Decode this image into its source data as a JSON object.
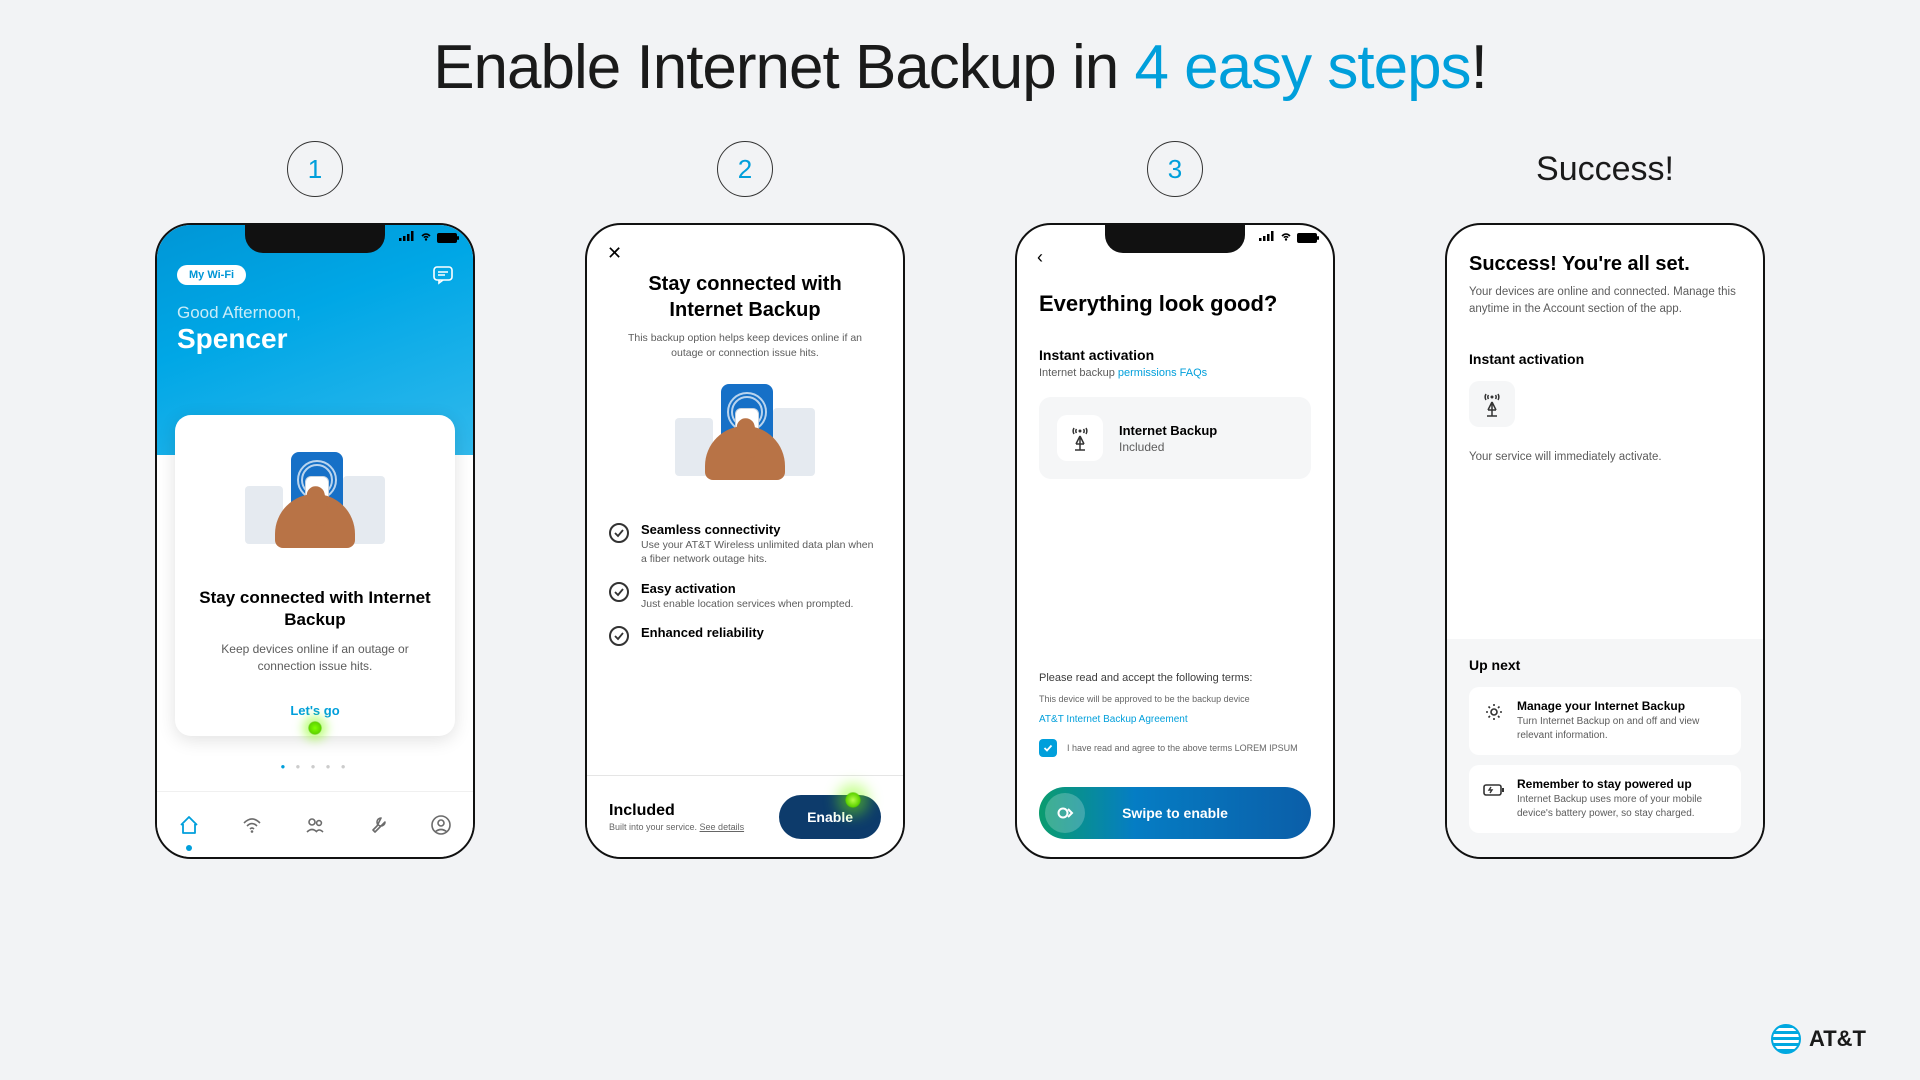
{
  "title_prefix": "Enable Internet Backup in ",
  "title_accent": "4 easy steps",
  "title_suffix": "!",
  "steps": {
    "s1": "1",
    "s2": "2",
    "s3": "3",
    "s4": "Success!"
  },
  "screen1": {
    "pill": "My Wi-Fi",
    "greeting": "Good Afternoon,",
    "name": "Spencer",
    "card_title": "Stay connected with Internet Backup",
    "card_sub": "Keep devices online if an outage or connection issue hits.",
    "cta": "Let's go"
  },
  "screen2": {
    "title": "Stay connected with Internet Backup",
    "sub": "This backup option helps keep devices online if an outage or connection issue hits.",
    "f1_t": "Seamless connectivity",
    "f1_s": "Use your AT&T Wireless unlimited data plan when a fiber network outage hits.",
    "f2_t": "Easy activation",
    "f2_s": "Just enable location services when prompted.",
    "f3_t": "Enhanced reliability",
    "footer_title": "Included",
    "footer_sub_a": "Built into your service. ",
    "footer_sub_b": "See details",
    "enable": "Enable"
  },
  "screen3": {
    "title": "Everything look good?",
    "section": "Instant activation",
    "faq_prefix": "Internet backup ",
    "faq_link": "permissions FAQs",
    "card_t": "Internet Backup",
    "card_s": "Included",
    "terms_h": "Please read and accept the following terms:",
    "terms_line": "This device will be approved to be the backup device",
    "agree_link": "AT&T Internet Backup Agreement",
    "cb_label": "I have read and agree to the above terms LOREM IPSUM",
    "swipe": "Swipe to enable"
  },
  "screen4": {
    "title": "Success! You're all set.",
    "sub": "Your devices are online and connected. Manage this anytime in the Account section of the app.",
    "section": "Instant activation",
    "note": "Your service will immediately activate.",
    "upnext": "Up next",
    "c1_t": "Manage your Internet Backup",
    "c1_s": "Turn Internet Backup on and off and view relevant information.",
    "c2_t": "Remember to stay powered up",
    "c2_s": "Internet Backup uses more of your mobile device's battery power, so stay charged."
  },
  "brand": "AT&T"
}
